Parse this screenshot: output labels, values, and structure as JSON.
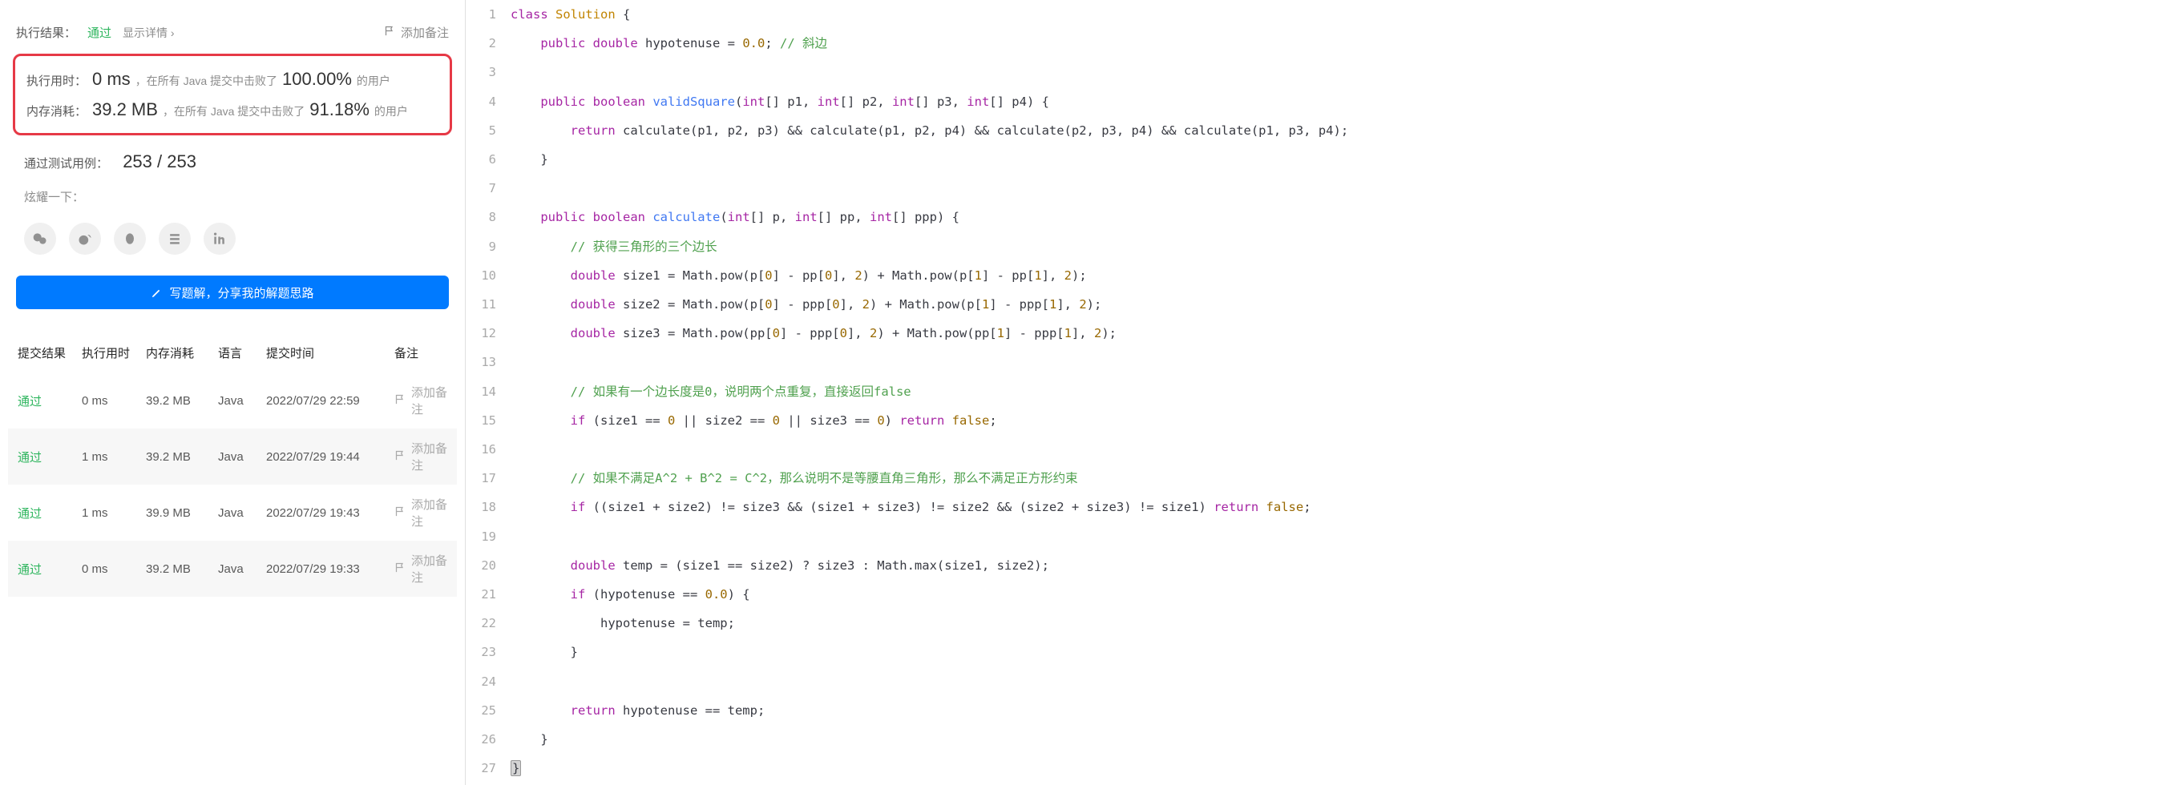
{
  "resultPanel": {
    "label": "执行结果：",
    "status": "通过",
    "showDetail": "显示详情",
    "addNote": "添加备注"
  },
  "stats": {
    "timeLabel": "执行用时：",
    "timeValue": "0 ms",
    "timeText1": "，在所有 Java 提交中击败了",
    "timePct": "100.00%",
    "timeText2": "的用户",
    "memLabel": "内存消耗：",
    "memValue": "39.2 MB",
    "memText1": "，在所有 Java 提交中击败了",
    "memPct": "91.18%",
    "memText2": "的用户"
  },
  "testcases": {
    "label": "通过测试用例：",
    "value": "253 / 253"
  },
  "shareLabel": "炫耀一下：",
  "writeSolution": "写题解，分享我的解题思路",
  "table": {
    "headers": {
      "result": "提交结果",
      "time": "执行用时",
      "mem": "内存消耗",
      "lang": "语言",
      "date": "提交时间",
      "note": "备注"
    },
    "rows": [
      {
        "result": "通过",
        "time": "0 ms",
        "mem": "39.2 MB",
        "lang": "Java",
        "date": "2022/07/29 22:59",
        "note": "添加备注"
      },
      {
        "result": "通过",
        "time": "1 ms",
        "mem": "39.2 MB",
        "lang": "Java",
        "date": "2022/07/29 19:44",
        "note": "添加备注"
      },
      {
        "result": "通过",
        "time": "1 ms",
        "mem": "39.9 MB",
        "lang": "Java",
        "date": "2022/07/29 19:43",
        "note": "添加备注"
      },
      {
        "result": "通过",
        "time": "0 ms",
        "mem": "39.2 MB",
        "lang": "Java",
        "date": "2022/07/29 19:33",
        "note": "添加备注"
      }
    ]
  },
  "code": {
    "lines": [
      {
        "n": 1,
        "tokens": [
          {
            "t": "class ",
            "c": "tok-keyword"
          },
          {
            "t": "Solution",
            "c": "tok-type"
          },
          {
            "t": " {",
            "c": "tok-paren"
          }
        ]
      },
      {
        "n": 2,
        "tokens": [
          {
            "t": "    "
          },
          {
            "t": "public ",
            "c": "tok-keyword"
          },
          {
            "t": "double ",
            "c": "tok-keyword"
          },
          {
            "t": "hypotenuse = "
          },
          {
            "t": "0.0",
            "c": "tok-num"
          },
          {
            "t": "; "
          },
          {
            "t": "// 斜边",
            "c": "tok-comment"
          }
        ]
      },
      {
        "n": 3,
        "tokens": [
          {
            "t": ""
          }
        ]
      },
      {
        "n": 4,
        "tokens": [
          {
            "t": "    "
          },
          {
            "t": "public ",
            "c": "tok-keyword"
          },
          {
            "t": "boolean ",
            "c": "tok-keyword"
          },
          {
            "t": "validSquare",
            "c": "tok-func"
          },
          {
            "t": "("
          },
          {
            "t": "int",
            "c": "tok-keyword"
          },
          {
            "t": "[] p1, "
          },
          {
            "t": "int",
            "c": "tok-keyword"
          },
          {
            "t": "[] p2, "
          },
          {
            "t": "int",
            "c": "tok-keyword"
          },
          {
            "t": "[] p3, "
          },
          {
            "t": "int",
            "c": "tok-keyword"
          },
          {
            "t": "[] p4) {"
          }
        ]
      },
      {
        "n": 5,
        "tokens": [
          {
            "t": "        "
          },
          {
            "t": "return ",
            "c": "tok-keyword"
          },
          {
            "t": "calculate(p1, p2, p3) && calculate(p1, p2, p4) && calculate(p2, p3, p4) && calculate(p1, p3, p4);"
          }
        ]
      },
      {
        "n": 6,
        "tokens": [
          {
            "t": "    }"
          }
        ]
      },
      {
        "n": 7,
        "tokens": [
          {
            "t": ""
          }
        ]
      },
      {
        "n": 8,
        "tokens": [
          {
            "t": "    "
          },
          {
            "t": "public ",
            "c": "tok-keyword"
          },
          {
            "t": "boolean ",
            "c": "tok-keyword"
          },
          {
            "t": "calculate",
            "c": "tok-func"
          },
          {
            "t": "("
          },
          {
            "t": "int",
            "c": "tok-keyword"
          },
          {
            "t": "[] p, "
          },
          {
            "t": "int",
            "c": "tok-keyword"
          },
          {
            "t": "[] pp, "
          },
          {
            "t": "int",
            "c": "tok-keyword"
          },
          {
            "t": "[] ppp) {"
          }
        ]
      },
      {
        "n": 9,
        "tokens": [
          {
            "t": "        "
          },
          {
            "t": "// 获得三角形的三个边长",
            "c": "tok-comment"
          }
        ]
      },
      {
        "n": 10,
        "tokens": [
          {
            "t": "        "
          },
          {
            "t": "double ",
            "c": "tok-keyword"
          },
          {
            "t": "size1 = Math.pow(p["
          },
          {
            "t": "0",
            "c": "tok-num"
          },
          {
            "t": "] - pp["
          },
          {
            "t": "0",
            "c": "tok-num"
          },
          {
            "t": "], "
          },
          {
            "t": "2",
            "c": "tok-num"
          },
          {
            "t": ") + Math.pow(p["
          },
          {
            "t": "1",
            "c": "tok-num"
          },
          {
            "t": "] - pp["
          },
          {
            "t": "1",
            "c": "tok-num"
          },
          {
            "t": "], "
          },
          {
            "t": "2",
            "c": "tok-num"
          },
          {
            "t": ");"
          }
        ]
      },
      {
        "n": 11,
        "tokens": [
          {
            "t": "        "
          },
          {
            "t": "double ",
            "c": "tok-keyword"
          },
          {
            "t": "size2 = Math.pow(p["
          },
          {
            "t": "0",
            "c": "tok-num"
          },
          {
            "t": "] - ppp["
          },
          {
            "t": "0",
            "c": "tok-num"
          },
          {
            "t": "], "
          },
          {
            "t": "2",
            "c": "tok-num"
          },
          {
            "t": ") + Math.pow(p["
          },
          {
            "t": "1",
            "c": "tok-num"
          },
          {
            "t": "] - ppp["
          },
          {
            "t": "1",
            "c": "tok-num"
          },
          {
            "t": "], "
          },
          {
            "t": "2",
            "c": "tok-num"
          },
          {
            "t": ");"
          }
        ]
      },
      {
        "n": 12,
        "tokens": [
          {
            "t": "        "
          },
          {
            "t": "double ",
            "c": "tok-keyword"
          },
          {
            "t": "size3 = Math.pow(pp["
          },
          {
            "t": "0",
            "c": "tok-num"
          },
          {
            "t": "] - ppp["
          },
          {
            "t": "0",
            "c": "tok-num"
          },
          {
            "t": "], "
          },
          {
            "t": "2",
            "c": "tok-num"
          },
          {
            "t": ") + Math.pow(pp["
          },
          {
            "t": "1",
            "c": "tok-num"
          },
          {
            "t": "] - ppp["
          },
          {
            "t": "1",
            "c": "tok-num"
          },
          {
            "t": "], "
          },
          {
            "t": "2",
            "c": "tok-num"
          },
          {
            "t": ");"
          }
        ]
      },
      {
        "n": 13,
        "tokens": [
          {
            "t": ""
          }
        ]
      },
      {
        "n": 14,
        "tokens": [
          {
            "t": "        "
          },
          {
            "t": "// 如果有一个边长度是0，说明两个点重复，直接返回false",
            "c": "tok-comment"
          }
        ]
      },
      {
        "n": 15,
        "tokens": [
          {
            "t": "        "
          },
          {
            "t": "if ",
            "c": "tok-keyword"
          },
          {
            "t": "(size1 == "
          },
          {
            "t": "0",
            "c": "tok-num"
          },
          {
            "t": " || size2 == "
          },
          {
            "t": "0",
            "c": "tok-num"
          },
          {
            "t": " || size3 == "
          },
          {
            "t": "0",
            "c": "tok-num"
          },
          {
            "t": ") "
          },
          {
            "t": "return ",
            "c": "tok-keyword"
          },
          {
            "t": "false",
            "c": "tok-bool"
          },
          {
            "t": ";"
          }
        ]
      },
      {
        "n": 16,
        "tokens": [
          {
            "t": ""
          }
        ]
      },
      {
        "n": 17,
        "tokens": [
          {
            "t": "        "
          },
          {
            "t": "// 如果不满足A^2 + B^2 = C^2，那么说明不是等腰直角三角形，那么不满足正方形约束",
            "c": "tok-comment"
          }
        ]
      },
      {
        "n": 18,
        "tokens": [
          {
            "t": "        "
          },
          {
            "t": "if ",
            "c": "tok-keyword"
          },
          {
            "t": "((size1 + size2) != size3 && (size1 + size3) != size2 && (size2 + size3) != size1) "
          },
          {
            "t": "return ",
            "c": "tok-keyword"
          },
          {
            "t": "false",
            "c": "tok-bool"
          },
          {
            "t": ";"
          }
        ]
      },
      {
        "n": 19,
        "tokens": [
          {
            "t": ""
          }
        ]
      },
      {
        "n": 20,
        "tokens": [
          {
            "t": "        "
          },
          {
            "t": "double ",
            "c": "tok-keyword"
          },
          {
            "t": "temp = (size1 == size2) ? size3 : Math.max(size1, size2);"
          }
        ]
      },
      {
        "n": 21,
        "tokens": [
          {
            "t": "        "
          },
          {
            "t": "if ",
            "c": "tok-keyword"
          },
          {
            "t": "(hypotenuse == "
          },
          {
            "t": "0.0",
            "c": "tok-num"
          },
          {
            "t": ") {"
          }
        ]
      },
      {
        "n": 22,
        "tokens": [
          {
            "t": "            hypotenuse = temp;"
          }
        ]
      },
      {
        "n": 23,
        "tokens": [
          {
            "t": "        }"
          }
        ]
      },
      {
        "n": 24,
        "tokens": [
          {
            "t": ""
          }
        ]
      },
      {
        "n": 25,
        "tokens": [
          {
            "t": "        "
          },
          {
            "t": "return ",
            "c": "tok-keyword"
          },
          {
            "t": "hypotenuse == temp;"
          }
        ]
      },
      {
        "n": 26,
        "tokens": [
          {
            "t": "    }"
          }
        ]
      },
      {
        "n": 27,
        "tokens": [
          {
            "t": "}",
            "c": "tok-bg-brk"
          }
        ]
      }
    ]
  }
}
